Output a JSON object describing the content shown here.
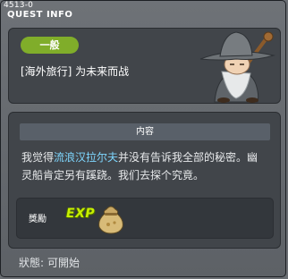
{
  "window": {
    "quest_id": "4513-0",
    "title": "QUEST INFO"
  },
  "quest": {
    "tag": "一般",
    "name": "[海外旅行] 为未来而战"
  },
  "content": {
    "header": "内容",
    "desc_pre": "我觉得",
    "desc_highlight": "流浪汉拉尔夫",
    "desc_post_line1": "并没有告诉我全部的秘密。幽",
    "desc_line2": "灵船肯定另有蹊跷。我们去探个究竟。"
  },
  "reward": {
    "label": "獎勵",
    "exp_text": "EXP"
  },
  "status": {
    "label": "狀態:",
    "value": "可開始"
  },
  "colors": {
    "tag_green": "#80ad2a",
    "highlight_blue": "#7ed7ff",
    "exp_yellow": "#c8f000"
  }
}
